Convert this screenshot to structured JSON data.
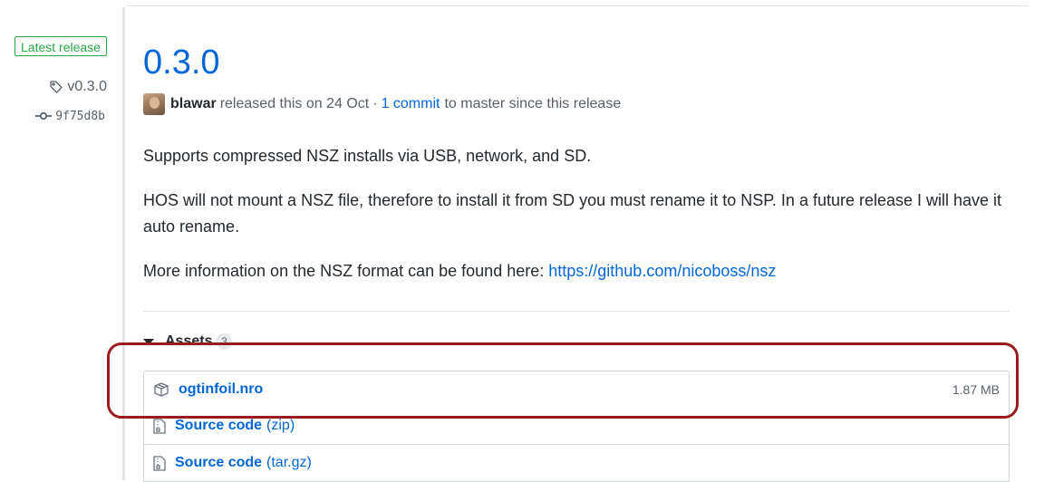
{
  "release": {
    "badge": "Latest release",
    "tag": "v0.3.0",
    "commit_sha": "9f75d8b",
    "title": "0.3.0",
    "author": "blawar",
    "released_text": "released this on 24 Oct",
    "separator": "·",
    "commits_link": "1 commit",
    "commits_suffix": "to master since this release"
  },
  "body": {
    "paragraph_1": "Supports compressed NSZ installs via USB, network, and SD.",
    "paragraph_2": "HOS will not mount a NSZ file, therefore to install it from SD you must rename it to NSP. In a future release I will have it auto rename.",
    "paragraph_3_text": "More information on the NSZ format can be found here:",
    "paragraph_3_link": "https://github.com/nicoboss/nsz"
  },
  "assets": {
    "label": "Assets",
    "count": "3",
    "items": [
      {
        "name": "ogtinfoil.nro",
        "ext": "",
        "size": "1.87 MB",
        "icon": "package-icon"
      },
      {
        "name": "Source code",
        "ext": "(zip)",
        "size": "",
        "icon": "file-zip-icon"
      },
      {
        "name": "Source code",
        "ext": "(tar.gz)",
        "size": "",
        "icon": "file-zip-icon"
      }
    ]
  },
  "colors": {
    "link": "#0366d6",
    "badge_green": "#28a745",
    "highlight": "#9a1b1f"
  }
}
